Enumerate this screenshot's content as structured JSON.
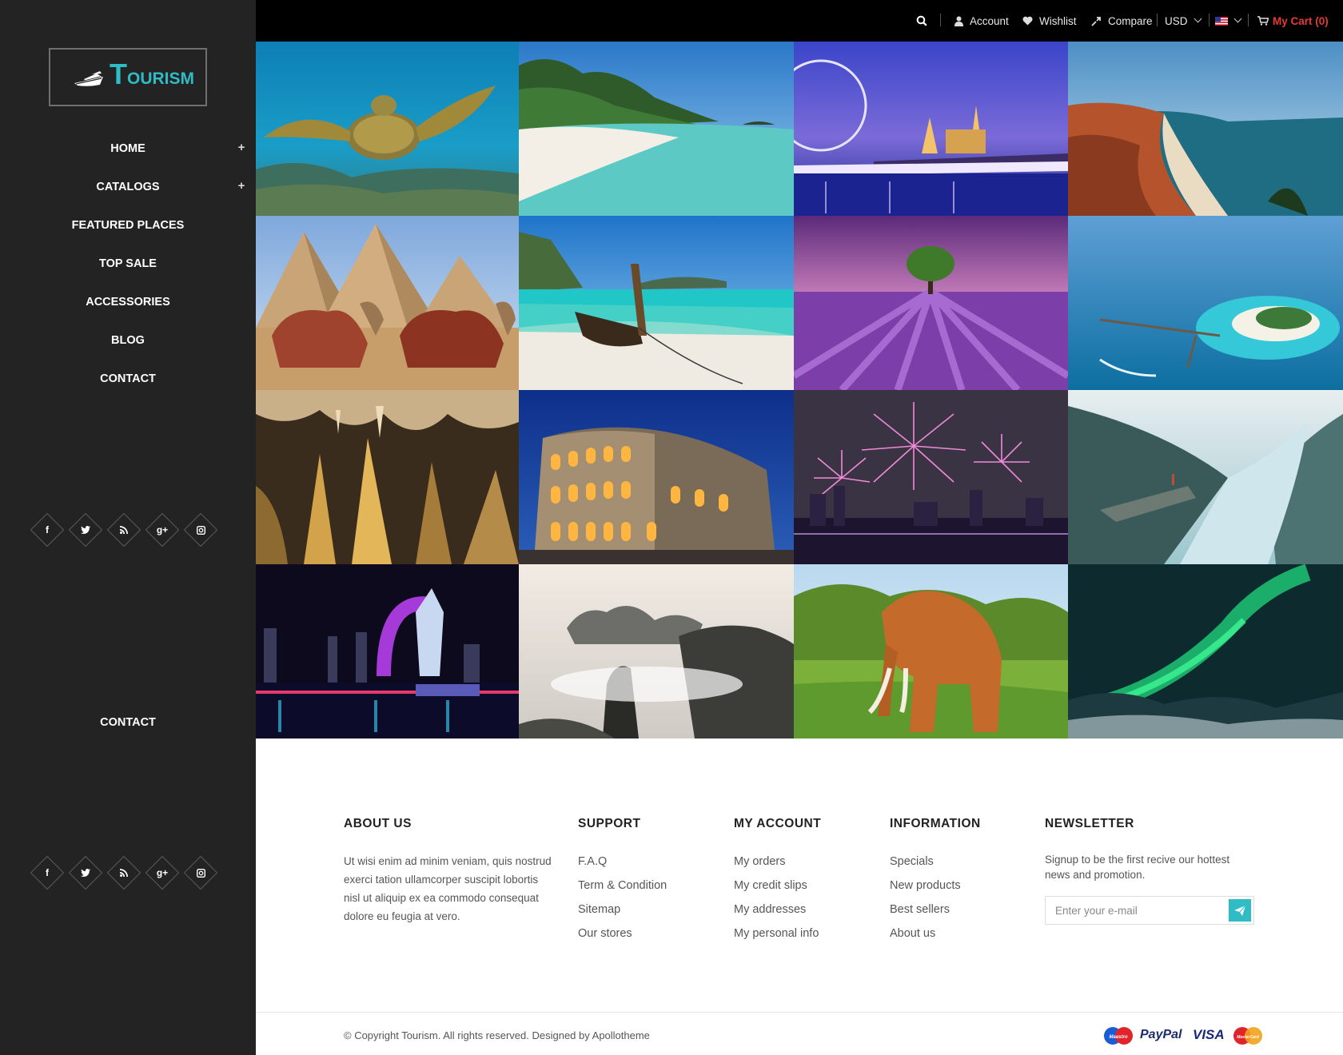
{
  "brand": {
    "initial": "T",
    "rest": "OURISM"
  },
  "nav": {
    "items": [
      {
        "label": "HOME",
        "expandable": true
      },
      {
        "label": "CATALOGS",
        "expandable": true
      },
      {
        "label": "FEATURED PLACES",
        "expandable": false
      },
      {
        "label": "TOP SALE",
        "expandable": false
      },
      {
        "label": "ACCESSORIES",
        "expandable": false
      },
      {
        "label": "BLOG",
        "expandable": false
      },
      {
        "label": "CONTACT",
        "expandable": false
      }
    ],
    "contact_label": "CONTACT",
    "plus_glyph": "+"
  },
  "social": [
    {
      "icon": "facebook-icon",
      "glyph": "f"
    },
    {
      "icon": "twitter-icon",
      "glyph": "t"
    },
    {
      "icon": "rss-icon",
      "glyph": "rss"
    },
    {
      "icon": "google-plus-icon",
      "glyph": "g+"
    },
    {
      "icon": "instagram-icon",
      "glyph": "ig"
    }
  ],
  "topbar": {
    "account": "Account",
    "wishlist": "Wishlist",
    "compare": "Compare",
    "currency": "USD",
    "language_icon": "us-flag-icon",
    "cart": "My Cart (0)"
  },
  "gallery": {
    "tiles": [
      "sea-turtle",
      "white-sand-beach",
      "london-eye-night",
      "red-cliff-coast",
      "pyramids-camels",
      "longtail-boat",
      "lavender-field-tree",
      "tropical-island-resort",
      "cave-stalactites",
      "colosseum-night",
      "fireworks-city",
      "fjord-cliff",
      "dragon-fountain-night",
      "misty-mountains",
      "elephant-savanna",
      "aurora-borealis"
    ]
  },
  "footer": {
    "about": {
      "title": "ABOUT US",
      "text": "Ut wisi enim ad minim veniam, quis nostrud exerci tation ullamcorper suscipit lobortis nisl ut aliquip ex ea commodo consequat dolore eu feugia at vero."
    },
    "support": {
      "title": "SUPPORT",
      "links": [
        "F.A.Q",
        "Term & Condition",
        "Sitemap",
        "Our stores"
      ]
    },
    "account": {
      "title": "MY ACCOUNT",
      "links": [
        "My orders",
        "My credit slips",
        "My addresses",
        "My personal info"
      ]
    },
    "information": {
      "title": "INFORMATION",
      "links": [
        "Specials",
        "New products",
        "Best sellers",
        "About us"
      ]
    },
    "newsletter": {
      "title": "NEWSLETTER",
      "text": "Signup to be the first recive our hottest news and promotion.",
      "placeholder": "Enter your e-mail"
    },
    "copyright": "© Copyright Tourism. All rights reserved. Designed by Apollotheme",
    "payments": {
      "paypal": "PayPal",
      "visa": "VISA",
      "maestro": "Maestro",
      "mastercard": "MasterCard"
    }
  },
  "colors": {
    "accent": "#2fbcc4",
    "sidebar_bg": "#232323",
    "topbar_bg": "#000000",
    "cart": "#e53935"
  }
}
